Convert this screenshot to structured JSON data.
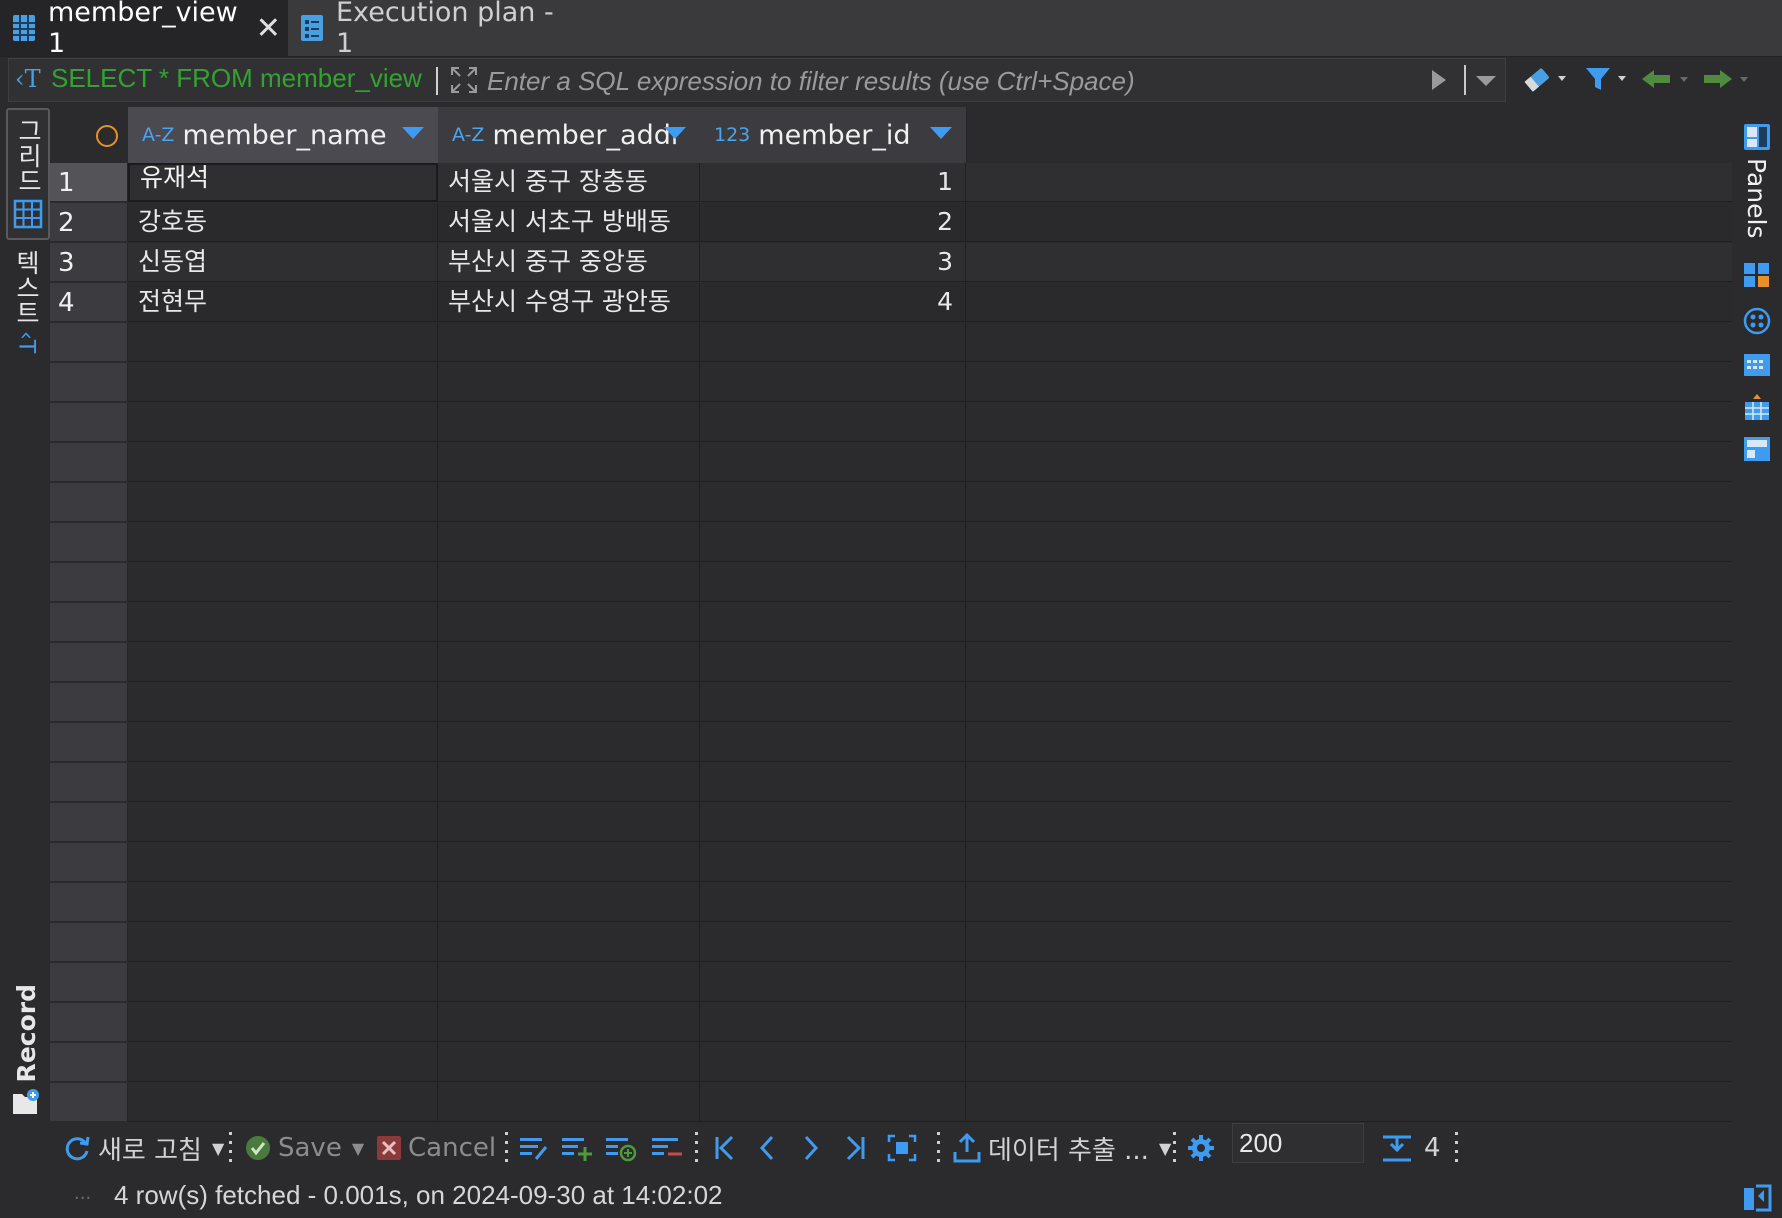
{
  "tabs": [
    {
      "label": "member_view 1",
      "icon": "grid-icon",
      "active": true
    },
    {
      "label": "Execution plan - 1",
      "icon": "plan-icon",
      "active": false
    }
  ],
  "filter": {
    "query_text": "SELECT * FROM member_view",
    "placeholder": "Enter a SQL expression to filter results (use Ctrl+Space)"
  },
  "left_tabs": {
    "grid": "그리드",
    "text": "텍스트",
    "record": "Record"
  },
  "grid": {
    "columns": [
      {
        "type_badge": "A-Z",
        "name": "member_name"
      },
      {
        "type_badge": "A-Z",
        "name": "member_addr"
      },
      {
        "type_badge": "123",
        "name": "member_id"
      }
    ],
    "rows": [
      {
        "num": "1",
        "member_name": "유재석",
        "member_addr": "서울시 중구 장충동",
        "member_id": "1"
      },
      {
        "num": "2",
        "member_name": "강호동",
        "member_addr": "서울시 서초구 방배동",
        "member_id": "2"
      },
      {
        "num": "3",
        "member_name": "신동엽",
        "member_addr": "부산시 중구 중앙동",
        "member_id": "3"
      },
      {
        "num": "4",
        "member_name": "전현무",
        "member_addr": "부산시 수영구 광안동",
        "member_id": "4"
      }
    ]
  },
  "right_panel": {
    "label": "Panels"
  },
  "bottom_toolbar": {
    "refresh_label": "새로 고침",
    "save_label": "Save",
    "cancel_label": "Cancel",
    "export_label": "데이터 추출 ...",
    "fetch_limit": "200",
    "row_count": "4"
  },
  "status": {
    "text": "4 row(s) fetched - 0.001s, on 2024-09-30 at 14:02:02"
  },
  "colors": {
    "accent_blue": "#3e9bef",
    "query_green": "#2fa52f",
    "background": "#2b2b2d"
  }
}
